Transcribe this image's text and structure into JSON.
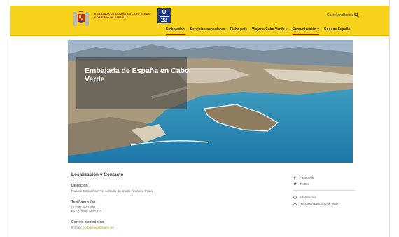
{
  "header": {
    "logo_text": "EMBAJADA DE ESPAÑA EN CABO VERDE · GOBIERNO DE ESPAÑA",
    "badge_line1": "U",
    "badge_line2": "23",
    "language": "Castellano ▾",
    "search_label": "Buscar",
    "brand_color": "#f7d21b"
  },
  "nav": [
    {
      "label": "Embajada ▾",
      "active": true
    },
    {
      "label": "Servicios consulares",
      "active": false
    },
    {
      "label": "Ficha país",
      "active": false
    },
    {
      "label": "Viajar a Cabo Verde ▾",
      "active": false
    },
    {
      "label": "Comunicación ▾",
      "active": true
    },
    {
      "label": "Conoce España",
      "active": false
    }
  ],
  "hero": {
    "title": "Embajada de España en Cabo Verde"
  },
  "contact": {
    "heading": "Localización y Contacto",
    "address_label": "Dirección",
    "address_value": "Rua de Espanha nº 1, Achada de Santo António, Praia.",
    "phone_label": "Teléfono y fax",
    "phone_value": "(+238) 2601800",
    "fax_value": "Fax (+238) 2621322",
    "email_label": "Correo electrónico",
    "email_prefix": "E-mail:",
    "email_value": "emb.praia@maec.es"
  },
  "side": {
    "facebook": "Facebook",
    "twitter": "Twitter",
    "info": "Información",
    "travel": "Recomendaciones de viaje"
  }
}
